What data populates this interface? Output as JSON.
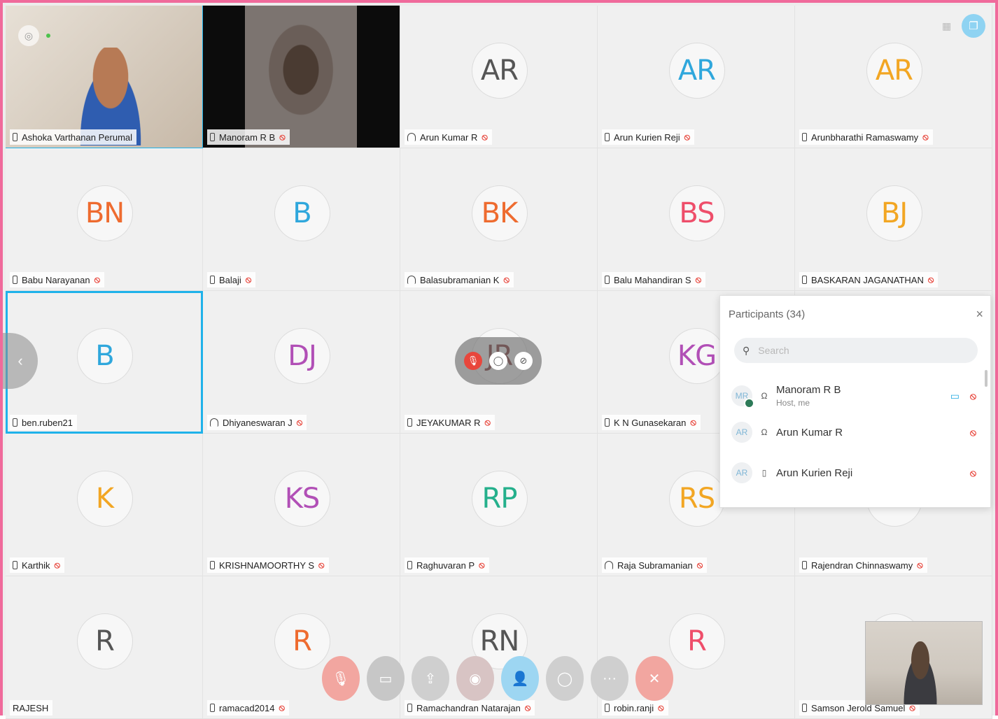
{
  "participants_panel": {
    "title": "Participants (34)",
    "close_glyph": "×",
    "search_placeholder": "Search",
    "rows": [
      {
        "initials": "MR",
        "name": "Manoram R B",
        "sub": "Host, me",
        "device": "headset",
        "video": true,
        "muted": true
      },
      {
        "initials": "AR",
        "name": "Arun Kumar R",
        "sub": "",
        "device": "headset",
        "video": false,
        "muted": true
      },
      {
        "initials": "AR",
        "name": "Arun Kurien  Reji",
        "sub": "",
        "device": "phone",
        "video": false,
        "muted": true
      }
    ]
  },
  "tiles": [
    {
      "initials": "",
      "name": "Ashoka Varthanan  Perumal",
      "color": "",
      "device": "phone",
      "muted": false,
      "video": "v1",
      "active": true
    },
    {
      "initials": "",
      "name": "Manoram R B",
      "color": "",
      "device": "phone",
      "muted": true,
      "video": "v2",
      "active": false
    },
    {
      "initials": "AR",
      "name": "Arun Kumar R",
      "color": "#555555",
      "device": "headset",
      "muted": true,
      "video": "",
      "active": false
    },
    {
      "initials": "AR",
      "name": "Arun Kurien  Reji",
      "color": "#2fa7dc",
      "device": "phone",
      "muted": true,
      "video": "",
      "active": false
    },
    {
      "initials": "AR",
      "name": "Arunbharathi Ramaswamy",
      "color": "#f2a623",
      "device": "phone",
      "muted": true,
      "video": "",
      "active": false
    },
    {
      "initials": "BN",
      "name": "Babu Narayanan",
      "color": "#ee6b2f",
      "device": "phone",
      "muted": true,
      "video": "",
      "active": false
    },
    {
      "initials": "B",
      "name": "Balaji",
      "color": "#2fa7dc",
      "device": "phone",
      "muted": true,
      "video": "",
      "active": false
    },
    {
      "initials": "BK",
      "name": "Balasubramanian K",
      "color": "#ee6b2f",
      "device": "headset",
      "muted": true,
      "video": "",
      "active": false
    },
    {
      "initials": "BS",
      "name": "Balu  Mahandiran S",
      "color": "#ee4e6a",
      "device": "phone",
      "muted": true,
      "video": "",
      "active": false
    },
    {
      "initials": "BJ",
      "name": "BASKARAN JAGANATHAN",
      "color": "#f2a623",
      "device": "phone",
      "muted": true,
      "video": "",
      "active": false
    },
    {
      "initials": "B",
      "name": "ben.ruben21",
      "color": "#2fa7dc",
      "device": "phone",
      "muted": false,
      "video": "",
      "active": true
    },
    {
      "initials": "DJ",
      "name": "Dhiyaneswaran J",
      "color": "#b14fb6",
      "device": "headset",
      "muted": true,
      "video": "",
      "active": false
    },
    {
      "initials": "JR",
      "name": "JEYAKUMAR R",
      "color": "#7a2c2c",
      "device": "phone",
      "muted": true,
      "video": "",
      "active": false
    },
    {
      "initials": "KG",
      "name": "K N Gunasekaran",
      "color": "#b14fb6",
      "device": "phone",
      "muted": true,
      "video": "",
      "active": false
    },
    {
      "initials": "",
      "name": "",
      "color": "#999999",
      "device": "",
      "muted": false,
      "video": "",
      "active": false
    },
    {
      "initials": "K",
      "name": "Karthik",
      "color": "#f2a623",
      "device": "phone",
      "muted": true,
      "video": "",
      "active": false
    },
    {
      "initials": "KS",
      "name": "KRISHNAMOORTHY S",
      "color": "#b14fb6",
      "device": "phone",
      "muted": true,
      "video": "",
      "active": false
    },
    {
      "initials": "RP",
      "name": "Raghuvaran P",
      "color": "#25b08c",
      "device": "phone",
      "muted": true,
      "video": "",
      "active": false
    },
    {
      "initials": "RS",
      "name": "Raja Subramanian",
      "color": "#f2a623",
      "device": "headset",
      "muted": true,
      "video": "",
      "active": false
    },
    {
      "initials": "",
      "name": "Rajendran Chinnaswamy",
      "color": "#999999",
      "device": "phone",
      "muted": true,
      "video": "",
      "active": false
    },
    {
      "initials": "R",
      "name": "RAJESH",
      "color": "#555555",
      "device": "",
      "muted": false,
      "video": "",
      "active": false
    },
    {
      "initials": "R",
      "name": "ramacad2014",
      "color": "#ee6b2f",
      "device": "phone",
      "muted": true,
      "video": "",
      "active": false
    },
    {
      "initials": "RN",
      "name": "Ramachandran Natarajan",
      "color": "#555555",
      "device": "phone",
      "muted": true,
      "video": "",
      "active": false
    },
    {
      "initials": "R",
      "name": "robin.ranji",
      "color": "#ee4e6a",
      "device": "phone",
      "muted": true,
      "video": "",
      "active": false
    },
    {
      "initials": "",
      "name": "Samson Jerold  Samuel",
      "color": "#999999",
      "device": "phone",
      "muted": true,
      "video": "",
      "active": false
    }
  ],
  "floating_controls": {
    "mute_glyph": "🎙",
    "chat_glyph": "◯",
    "more_glyph": "⊘"
  },
  "toolbar": [
    {
      "icon": "mute-icon",
      "glyph": "🎙",
      "color": "#f2a6a0"
    },
    {
      "icon": "stop-video-icon",
      "glyph": "▭",
      "color": "#c7c7c7"
    },
    {
      "icon": "share-icon",
      "glyph": "⇪",
      "color": "#cfcfcf"
    },
    {
      "icon": "record-icon",
      "glyph": "◉",
      "color": "#d8c4c4"
    },
    {
      "icon": "participants-icon",
      "glyph": "👤",
      "color": "#9dd6f2"
    },
    {
      "icon": "chat-icon",
      "glyph": "◯",
      "color": "#cfcfcf"
    },
    {
      "icon": "more-icon",
      "glyph": "···",
      "color": "#cfcfcf"
    },
    {
      "icon": "leave-icon",
      "glyph": "✕",
      "color": "#f2a6a0"
    }
  ],
  "side_arrow_glyph": "‹",
  "corner": {
    "grid_glyph": "▦",
    "layout_glyph": "❐"
  }
}
